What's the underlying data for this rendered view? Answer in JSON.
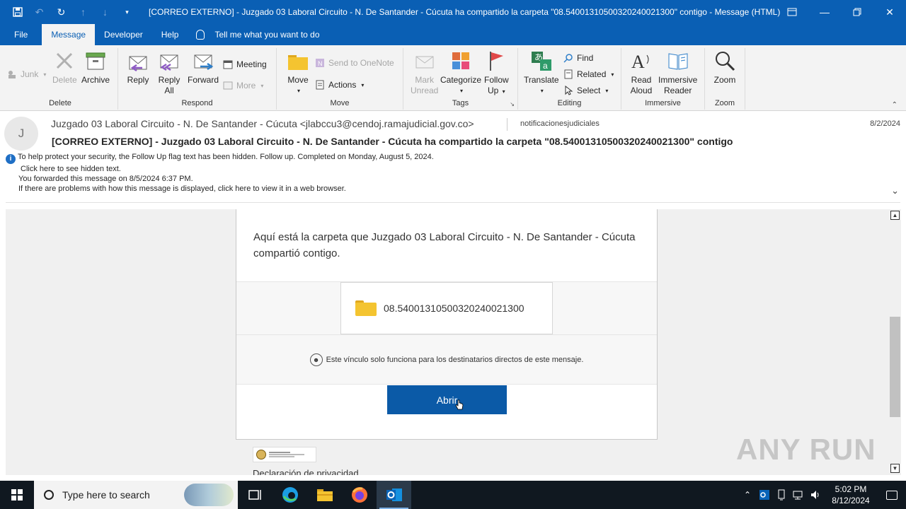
{
  "window": {
    "title": "[CORREO EXTERNO] - Juzgado 03 Laboral Circuito - N. De Santander - Cúcuta ha compartido la carpeta \"08.54001310500320240021300\" contigo  -  Message (HTML)"
  },
  "tabs": [
    {
      "label": "File"
    },
    {
      "label": "Message"
    },
    {
      "label": "Developer"
    },
    {
      "label": "Help"
    }
  ],
  "tellme": "Tell me what you want to do",
  "ribbon": {
    "delete_group": {
      "label": "Delete",
      "junk": "Junk",
      "delete": "Delete",
      "archive": "Archive"
    },
    "respond_group": {
      "label": "Respond",
      "reply": "Reply",
      "reply_all_1": "Reply",
      "reply_all_2": "All",
      "forward": "Forward",
      "meeting": "Meeting",
      "more": "More"
    },
    "move_group": {
      "label": "Move",
      "move": "Move",
      "onenote": "Send to OneNote",
      "actions": "Actions"
    },
    "tags_group": {
      "label": "Tags",
      "mark_1": "Mark",
      "mark_2": "Unread",
      "categorize": "Categorize",
      "follow_1": "Follow",
      "follow_2": "Up"
    },
    "editing_group": {
      "label": "Editing",
      "translate": "Translate",
      "find": "Find",
      "related": "Related",
      "select": "Select"
    },
    "immersive_group": {
      "label": "Immersive",
      "read_1": "Read",
      "read_2": "Aloud",
      "imm_1": "Immersive",
      "imm_2": "Reader"
    },
    "zoom_group": {
      "label": "Zoom",
      "zoom": "Zoom"
    }
  },
  "header": {
    "avatar_initial": "J",
    "from": "Juzgado 03 Laboral Circuito - N. De Santander - Cúcuta <jlabccu3@cendoj.ramajudicial.gov.co>",
    "to": "notificacionesjudiciales",
    "date": "8/2/2024",
    "subject": "[CORREO EXTERNO] - Juzgado 03 Laboral Circuito - N. De Santander - Cúcuta ha compartido la carpeta \"08.54001310500320240021300\" contigo",
    "info_lines": [
      "To help protect your security, the Follow Up flag text has been hidden. Follow up.  Completed on Monday, August 5, 2024.",
      "Click here to see hidden text.",
      "You forwarded this message on 8/5/2024 6:37 PM.",
      "If there are problems with how this message is displayed, click here to view it in a web browser."
    ]
  },
  "body": {
    "message": "Aquí está la carpeta que Juzgado 03 Laboral Circuito - N. De Santander - Cúcuta compartió contigo.",
    "folder_name": "08.54001310500320240021300",
    "link_note": "Este vínculo solo funciona para los destinatarios directos de este mensaje.",
    "open_button": "Abrir",
    "privacy": "Declaración de privacidad"
  },
  "watermark": "ANY RUN",
  "taskbar": {
    "search_placeholder": "Type here to search",
    "time": "5:02 PM",
    "date": "8/12/2024"
  },
  "colors": {
    "accent": "#0a5fb4",
    "open_button": "#0b5aa7",
    "taskbar": "#101820"
  }
}
